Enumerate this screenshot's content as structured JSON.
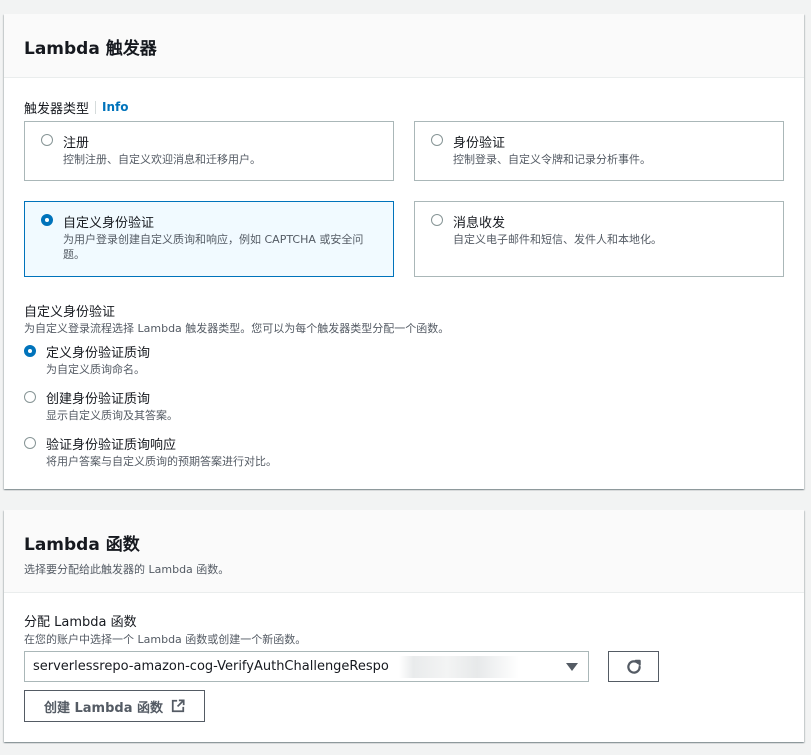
{
  "trigger_panel": {
    "title": "Lambda 触发器",
    "field_label": "触发器类型",
    "info_link": "Info",
    "tiles": [
      {
        "title": "注册",
        "desc": "控制注册、自定义欢迎消息和迁移用户。",
        "selected": false
      },
      {
        "title": "身份验证",
        "desc": "控制登录、自定义令牌和记录分析事件。",
        "selected": false
      },
      {
        "title": "自定义身份验证",
        "desc": "为用户登录创建自定义质询和响应，例如 CAPTCHA 或安全问题。",
        "selected": true
      },
      {
        "title": "消息收发",
        "desc": "自定义电子邮件和短信、发件人和本地化。",
        "selected": false
      }
    ],
    "sub_title": "自定义身份验证",
    "sub_desc": "为自定义登录流程选择 Lambda 触发器类型。您可以为每个触发器类型分配一个函数。",
    "options": [
      {
        "title": "定义身份验证质询",
        "desc": "为自定义质询命名。",
        "selected": true
      },
      {
        "title": "创建身份验证质询",
        "desc": "显示自定义质询及其答案。",
        "selected": false
      },
      {
        "title": "验证身份验证质询响应",
        "desc": "将用户答案与自定义质询的预期答案进行对比。",
        "selected": false
      }
    ]
  },
  "function_panel": {
    "title": "Lambda 函数",
    "desc": "选择要分配给此触发器的 Lambda 函数。",
    "field_label": "分配 Lambda 函数",
    "field_desc": "在您的账户中选择一个 Lambda 函数或创建一个新函数。",
    "selected_function": "serverlessrepo-amazon-cog-VerifyAuthChallengeRespo",
    "refresh_icon": "refresh-icon",
    "create_button": "创建 Lambda 函数",
    "create_icon": "external-link-icon"
  },
  "colors": {
    "accent": "#0073bb",
    "selected_bg": "#f1faff",
    "border": "#aab7b8",
    "text": "#16191f",
    "secondary_text": "#545b64"
  }
}
